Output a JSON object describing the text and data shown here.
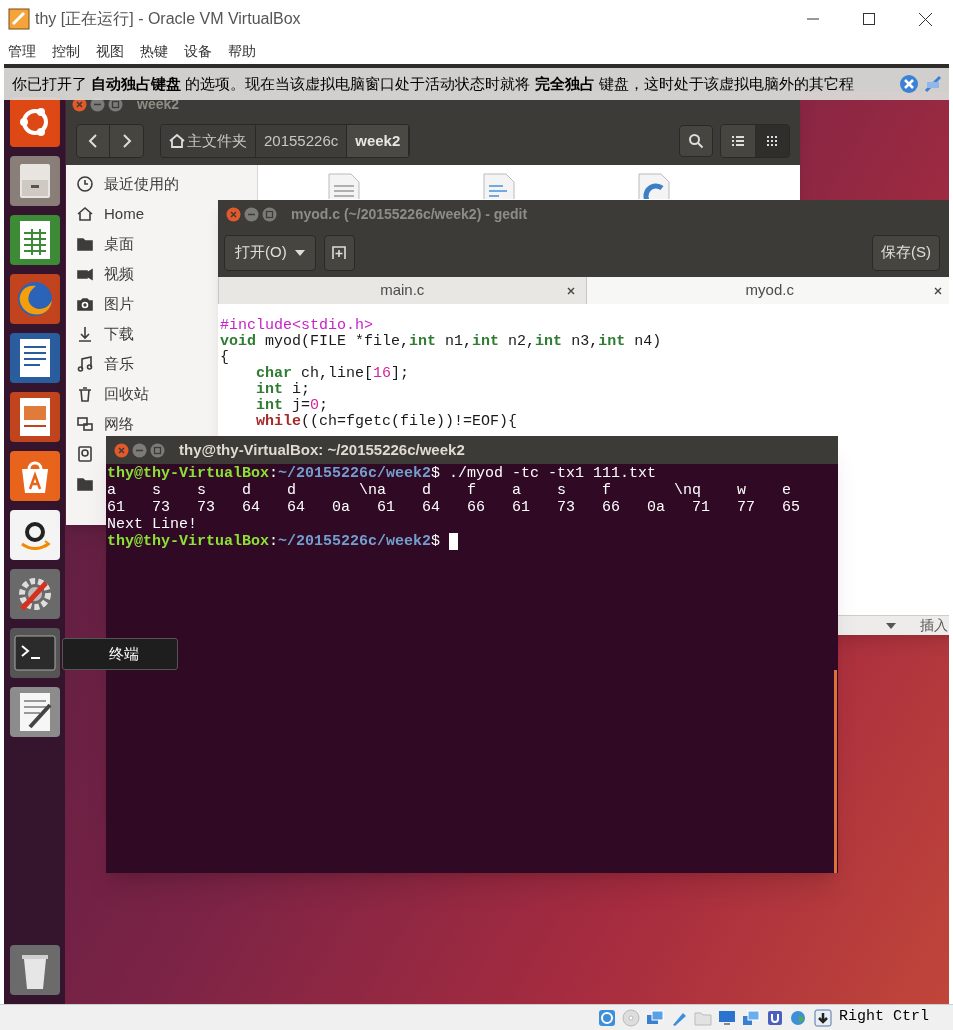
{
  "window": {
    "title": "thy [正在运行] - Oracle VM VirtualBox"
  },
  "menu": [
    "管理",
    "控制",
    "视图",
    "热键",
    "设备",
    "帮助"
  ],
  "notice": {
    "text": "你已打开了 **自动独占键盘** 的选项。现在当该虚拟电脑窗口处于活动状态时就将 **完全独占** 键盘，这时处于该虚拟电脑外的其它程"
  },
  "launcher": [
    {
      "kind": "ubuntu"
    },
    {
      "kind": "files"
    },
    {
      "kind": "spreadsheet"
    },
    {
      "kind": "browser"
    },
    {
      "kind": "writer"
    },
    {
      "kind": "presentation"
    },
    {
      "kind": "store"
    },
    {
      "kind": "shop"
    },
    {
      "kind": "settings"
    },
    {
      "kind": "terminal"
    },
    {
      "kind": "editor"
    },
    {
      "kind": "trash"
    }
  ],
  "tooltip": {
    "text": "终端"
  },
  "file_manager": {
    "title": "week2",
    "path": [
      {
        "label": "主文件夹",
        "selected": false
      },
      {
        "label": "20155226c",
        "selected": false
      },
      {
        "label": "week2",
        "selected": true
      }
    ],
    "view_modes": [
      {
        "kind": "list",
        "selected": false
      },
      {
        "kind": "grid",
        "selected": true
      }
    ],
    "places": [
      {
        "kind": "recent",
        "label": "最近使用的"
      },
      {
        "kind": "home",
        "label": "Home"
      },
      {
        "kind": "folder",
        "label": "桌面"
      },
      {
        "kind": "video",
        "label": "视频"
      },
      {
        "kind": "camera",
        "label": "图片"
      },
      {
        "kind": "download",
        "label": "下载"
      },
      {
        "kind": "music",
        "label": "音乐"
      },
      {
        "kind": "trash",
        "label": "回收站"
      },
      {
        "kind": "network",
        "label": "网络"
      },
      {
        "kind": "drive"
      },
      {
        "kind": "folder"
      }
    ],
    "files": [
      {
        "kind": "text"
      },
      {
        "kind": "code"
      },
      {
        "kind": "c"
      }
    ]
  },
  "gedit": {
    "title": "myod.c (~/20155226c/week2) - gedit",
    "open": "打开(O)",
    "save": "保存(S)",
    "tabs": [
      {
        "label": "main.c",
        "selected": false
      },
      {
        "label": "myod.c",
        "selected": true
      }
    ],
    "code": [
      {
        "tokens": [
          {
            "t": "#include<stdio.h>",
            "kind": "preproc"
          }
        ]
      },
      {
        "tokens": [
          {
            "t": "void",
            "kind": "keyword"
          },
          {
            "t": " myod(FILE *file,",
            "kind": "plain"
          },
          {
            "t": "int",
            "kind": "keyword"
          },
          {
            "t": " n1,",
            "kind": "plain"
          },
          {
            "t": "int",
            "kind": "keyword"
          },
          {
            "t": " n2,",
            "kind": "plain"
          },
          {
            "t": "int",
            "kind": "keyword"
          },
          {
            "t": " n3,",
            "kind": "plain"
          },
          {
            "t": "int",
            "kind": "keyword"
          },
          {
            "t": " n4)",
            "kind": "plain"
          }
        ]
      },
      {
        "tokens": [
          {
            "t": "{",
            "kind": "plain"
          }
        ],
        "children": [
          {
            "tokens": [
              {
                "t": "char",
                "kind": "keyword"
              },
              {
                "t": " ch,line[",
                "kind": "plain"
              },
              {
                "t": "16",
                "kind": "number"
              },
              {
                "t": "];",
                "kind": "plain"
              }
            ]
          },
          {
            "tokens": [
              {
                "t": "int",
                "kind": "keyword"
              },
              {
                "t": " i;",
                "kind": "plain"
              }
            ]
          },
          {
            "tokens": [
              {
                "t": "int",
                "kind": "keyword"
              },
              {
                "t": " j=",
                "kind": "plain"
              },
              {
                "t": "0",
                "kind": "number"
              },
              {
                "t": ";",
                "kind": "plain"
              }
            ]
          },
          {
            "tokens": [
              {
                "t": "while",
                "kind": "flow"
              },
              {
                "t": "((ch=fgetc(file))!=EOF){",
                "kind": "plain"
              }
            ]
          }
        ]
      }
    ],
    "status": "插入"
  },
  "terminal": {
    "title": "thy@thy-VirtualBox: ~/20155226c/week2",
    "lines": [
      {
        "cursor": false,
        "segments": [
          {
            "t": "thy@thy-VirtualBox",
            "kind": "user"
          },
          {
            "t": ":",
            "kind": "plain"
          },
          {
            "t": "~/20155226c/week2",
            "kind": "path"
          },
          {
            "t": "$ ./myod -tc -tx1 111.txt",
            "kind": "plain"
          }
        ]
      },
      {
        "cursor": false,
        "segments": [
          {
            "t": "a    s    s    d    d       \\na    d    f    a    s    f       \\nq    w    e",
            "kind": "plain"
          }
        ]
      },
      {
        "cursor": false,
        "segments": [
          {
            "t": "61   73   73   64   64   0a   61   64   66   61   73   66   0a   71   77   65",
            "kind": "plain"
          }
        ]
      },
      {
        "cursor": false,
        "segments": [
          {
            "t": "Next Line!",
            "kind": "plain"
          }
        ]
      },
      {
        "cursor": true,
        "segments": [
          {
            "t": "thy@thy-VirtualBox",
            "kind": "user"
          },
          {
            "t": ":",
            "kind": "plain"
          },
          {
            "t": "~/20155226c/week2",
            "kind": "path"
          },
          {
            "t": "$ ",
            "kind": "plain"
          }
        ]
      }
    ]
  },
  "status_bar": {
    "icons": [
      {
        "kind": "disk"
      },
      {
        "kind": "optical"
      },
      {
        "kind": "network"
      },
      {
        "kind": "usb"
      },
      {
        "kind": "shared"
      },
      {
        "kind": "display"
      },
      {
        "kind": "capture"
      },
      {
        "kind": "cpu"
      },
      {
        "kind": "mouse"
      },
      {
        "kind": "arrow"
      }
    ],
    "host_key": "Right Ctrl"
  }
}
